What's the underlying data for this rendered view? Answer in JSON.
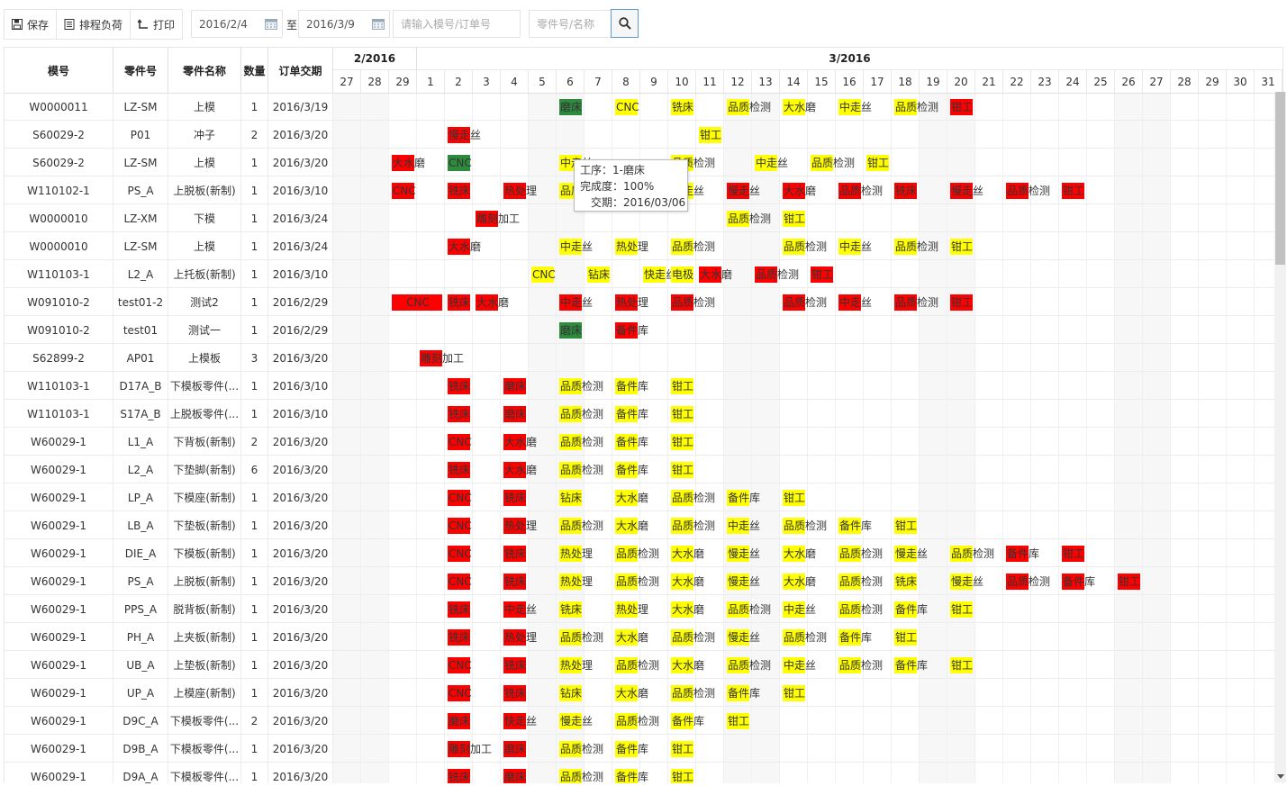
{
  "toolbar": {
    "save": "保存",
    "load": "排程负荷",
    "print": "打印",
    "date_from": "2016/2/4",
    "to": "至",
    "date_to": "2016/3/9",
    "mold_placeholder": "请输入模号/订单号",
    "part_placeholder": "零件号/名称"
  },
  "columns": [
    "模号",
    "零件号",
    "零件名称",
    "数量",
    "订单交期"
  ],
  "months": [
    "2/2016",
    "3/2016"
  ],
  "days": [
    "27",
    "28",
    "29",
    "1",
    "2",
    "3",
    "4",
    "5",
    "6",
    "7",
    "8",
    "9",
    "10",
    "11",
    "12",
    "13",
    "14",
    "15",
    "16",
    "17",
    "18",
    "19",
    "20",
    "21",
    "22",
    "23",
    "24",
    "25",
    "26",
    "27",
    "28",
    "29",
    "30",
    "31"
  ],
  "rows": [
    {
      "mold": "W0000011",
      "part": "LZ-SM",
      "name": "上模",
      "qty": "1",
      "due": "2016/3/19"
    },
    {
      "mold": "S60029-2",
      "part": "P01",
      "name": "冲子",
      "qty": "2",
      "due": "2016/3/20"
    },
    {
      "mold": "S60029-2",
      "part": "LZ-SM",
      "name": "上模",
      "qty": "1",
      "due": "2016/3/20"
    },
    {
      "mold": "W110102-1",
      "part": "PS_A",
      "name": "上脱板(新制)",
      "qty": "1",
      "due": "2016/3/10"
    },
    {
      "mold": "W0000010",
      "part": "LZ-XM",
      "name": "下模",
      "qty": "1",
      "due": "2016/3/24"
    },
    {
      "mold": "W0000010",
      "part": "LZ-SM",
      "name": "上模",
      "qty": "1",
      "due": "2016/3/24"
    },
    {
      "mold": "W110103-1",
      "part": "L2_A",
      "name": "上托板(新制)",
      "qty": "1",
      "due": "2016/3/10"
    },
    {
      "mold": "W091010-2",
      "part": "test01-2",
      "name": "测试2",
      "qty": "1",
      "due": "2016/2/29"
    },
    {
      "mold": "W091010-2",
      "part": "test01",
      "name": "测试一",
      "qty": "1",
      "due": "2016/2/29"
    },
    {
      "mold": "S62899-2",
      "part": "AP01",
      "name": "上模板",
      "qty": "3",
      "due": "2016/3/20"
    },
    {
      "mold": "W110103-1",
      "part": "D17A_B",
      "name": "下模板零件(...",
      "qty": "1",
      "due": "2016/3/10"
    },
    {
      "mold": "W110103-1",
      "part": "S17A_B",
      "name": "上脱板零件(...",
      "qty": "1",
      "due": "2016/3/10"
    },
    {
      "mold": "W60029-1",
      "part": "L1_A",
      "name": "下背板(新制)",
      "qty": "2",
      "due": "2016/3/20"
    },
    {
      "mold": "W60029-1",
      "part": "L2_A",
      "name": "下垫脚(新制)",
      "qty": "6",
      "due": "2016/3/20"
    },
    {
      "mold": "W60029-1",
      "part": "LP_A",
      "name": "下模座(新制)",
      "qty": "1",
      "due": "2016/3/20"
    },
    {
      "mold": "W60029-1",
      "part": "LB_A",
      "name": "下垫板(新制)",
      "qty": "1",
      "due": "2016/3/20"
    },
    {
      "mold": "W60029-1",
      "part": "DIE_A",
      "name": "下模板(新制)",
      "qty": "1",
      "due": "2016/3/20"
    },
    {
      "mold": "W60029-1",
      "part": "PS_A",
      "name": "上脱板(新制)",
      "qty": "1",
      "due": "2016/3/20"
    },
    {
      "mold": "W60029-1",
      "part": "PPS_A",
      "name": "脱背板(新制)",
      "qty": "1",
      "due": "2016/3/20"
    },
    {
      "mold": "W60029-1",
      "part": "PH_A",
      "name": "上夹板(新制)",
      "qty": "1",
      "due": "2016/3/20"
    },
    {
      "mold": "W60029-1",
      "part": "UB_A",
      "name": "上垫板(新制)",
      "qty": "1",
      "due": "2016/3/20"
    },
    {
      "mold": "W60029-1",
      "part": "UP_A",
      "name": "上模座(新制)",
      "qty": "1",
      "due": "2016/3/20"
    },
    {
      "mold": "W60029-1",
      "part": "D9C_A",
      "name": "下模板零件(...",
      "qty": "2",
      "due": "2016/3/20"
    },
    {
      "mold": "W60029-1",
      "part": "D9B_A",
      "name": "下模板零件(...",
      "qty": "1",
      "due": "2016/3/20"
    },
    {
      "mold": "W60029-1",
      "part": "D9A_A",
      "name": "下模板零件(...",
      "qty": "1",
      "due": "2016/3/20"
    }
  ],
  "tasks": [
    [
      {
        "c": 8,
        "t": "磨床",
        "k": "g"
      },
      {
        "c": 10,
        "t": "CNC",
        "k": "y"
      },
      {
        "c": 12,
        "t": "铣床",
        "k": "y"
      },
      {
        "c": 14,
        "t": "品质检测",
        "k": "y"
      },
      {
        "c": 16,
        "t": "大水磨",
        "k": "y"
      },
      {
        "c": 18,
        "t": "中走丝",
        "k": "y"
      },
      {
        "c": 20,
        "t": "品质检测",
        "k": "y"
      },
      {
        "c": 22,
        "t": "钳工",
        "k": "r"
      }
    ],
    [
      {
        "c": 4,
        "t": "慢走丝",
        "k": "r"
      },
      {
        "c": 13,
        "t": "钳工",
        "k": "y"
      }
    ],
    [
      {
        "c": 2,
        "t": "大水磨",
        "k": "r"
      },
      {
        "c": 4,
        "t": "CNC",
        "k": "g"
      },
      {
        "c": 8,
        "t": "中走丝",
        "k": "y"
      },
      {
        "c": 12,
        "t": "品质检测",
        "k": "y"
      },
      {
        "c": 15,
        "t": "中走丝",
        "k": "y"
      },
      {
        "c": 17,
        "t": "品质检测",
        "k": "y"
      },
      {
        "c": 19,
        "t": "钳工",
        "k": "y"
      }
    ],
    [
      {
        "c": 2,
        "t": "CNC",
        "k": "r"
      },
      {
        "c": 4,
        "t": "铣床",
        "k": "r"
      },
      {
        "c": 6,
        "t": "热处理",
        "k": "r"
      },
      {
        "c": 8,
        "t": "品质检测",
        "k": "y"
      },
      {
        "c": 10,
        "t": "大水磨",
        "k": "y"
      },
      {
        "c": 12,
        "t": "快走丝",
        "k": "y"
      },
      {
        "c": 14,
        "t": "慢走丝",
        "k": "r"
      },
      {
        "c": 16,
        "t": "大水磨",
        "k": "r"
      },
      {
        "c": 18,
        "t": "品质检测",
        "k": "r"
      },
      {
        "c": 20,
        "t": "铣床",
        "k": "r"
      },
      {
        "c": 22,
        "t": "慢走丝",
        "k": "r"
      },
      {
        "c": 24,
        "t": "品质检测",
        "k": "r"
      },
      {
        "c": 26,
        "t": "钳工",
        "k": "r"
      }
    ],
    [
      {
        "c": 5,
        "t": "雕刻加工",
        "k": "r"
      },
      {
        "c": 14,
        "t": "品质检测",
        "k": "y"
      },
      {
        "c": 16,
        "t": "钳工",
        "k": "y"
      }
    ],
    [
      {
        "c": 4,
        "t": "大水磨",
        "k": "r"
      },
      {
        "c": 8,
        "t": "中走丝",
        "k": "y"
      },
      {
        "c": 10,
        "t": "热处理",
        "k": "y"
      },
      {
        "c": 12,
        "t": "品质检测",
        "k": "y"
      },
      {
        "c": 16,
        "t": "品质检测",
        "k": "y"
      },
      {
        "c": 18,
        "t": "中走丝",
        "k": "y"
      },
      {
        "c": 20,
        "t": "品质检测",
        "k": "y"
      },
      {
        "c": 22,
        "t": "钳工",
        "k": "y"
      }
    ],
    [
      {
        "c": 7,
        "t": "CNC",
        "k": "y"
      },
      {
        "c": 9,
        "t": "钻床",
        "k": "y"
      },
      {
        "c": 11,
        "t": "快走丝",
        "k": "y"
      },
      {
        "c": 12,
        "t": "电极",
        "k": "y"
      },
      {
        "c": 13,
        "t": "大水磨",
        "k": "r"
      },
      {
        "c": 15,
        "t": "品质检测",
        "k": "r"
      },
      {
        "c": 17,
        "t": "钳工",
        "k": "r"
      }
    ],
    [
      {
        "c": 2,
        "t": "CNC",
        "k": "r",
        "w": 2
      },
      {
        "c": 4,
        "t": "铣床",
        "k": "r"
      },
      {
        "c": 5,
        "t": "大水磨",
        "k": "r"
      },
      {
        "c": 8,
        "t": "中走丝",
        "k": "r"
      },
      {
        "c": 10,
        "t": "热处理",
        "k": "r"
      },
      {
        "c": 12,
        "t": "品质检测",
        "k": "r"
      },
      {
        "c": 16,
        "t": "品质检测",
        "k": "r"
      },
      {
        "c": 18,
        "t": "中走丝",
        "k": "r"
      },
      {
        "c": 20,
        "t": "品质检测",
        "k": "r"
      },
      {
        "c": 22,
        "t": "钳工",
        "k": "r"
      }
    ],
    [
      {
        "c": 8,
        "t": "磨床",
        "k": "g"
      },
      {
        "c": 10,
        "t": "备件库",
        "k": "r"
      }
    ],
    [
      {
        "c": 3,
        "t": "雕刻加工",
        "k": "r"
      }
    ],
    [
      {
        "c": 4,
        "t": "铣床",
        "k": "r"
      },
      {
        "c": 6,
        "t": "磨床",
        "k": "r"
      },
      {
        "c": 8,
        "t": "品质检测",
        "k": "y"
      },
      {
        "c": 10,
        "t": "备件库",
        "k": "y"
      },
      {
        "c": 12,
        "t": "钳工",
        "k": "y"
      }
    ],
    [
      {
        "c": 4,
        "t": "铣床",
        "k": "r"
      },
      {
        "c": 6,
        "t": "磨床",
        "k": "r"
      },
      {
        "c": 8,
        "t": "品质检测",
        "k": "y"
      },
      {
        "c": 10,
        "t": "备件库",
        "k": "y"
      },
      {
        "c": 12,
        "t": "钳工",
        "k": "y"
      }
    ],
    [
      {
        "c": 4,
        "t": "CNC",
        "k": "r"
      },
      {
        "c": 6,
        "t": "大水磨",
        "k": "r"
      },
      {
        "c": 8,
        "t": "品质检测",
        "k": "y"
      },
      {
        "c": 10,
        "t": "备件库",
        "k": "y"
      },
      {
        "c": 12,
        "t": "钳工",
        "k": "y"
      }
    ],
    [
      {
        "c": 4,
        "t": "铣床",
        "k": "r"
      },
      {
        "c": 6,
        "t": "大水磨",
        "k": "r"
      },
      {
        "c": 8,
        "t": "品质检测",
        "k": "y"
      },
      {
        "c": 10,
        "t": "备件库",
        "k": "y"
      },
      {
        "c": 12,
        "t": "钳工",
        "k": "y"
      }
    ],
    [
      {
        "c": 4,
        "t": "CNC",
        "k": "r"
      },
      {
        "c": 6,
        "t": "铣床",
        "k": "r"
      },
      {
        "c": 8,
        "t": "钻床",
        "k": "y"
      },
      {
        "c": 10,
        "t": "大水磨",
        "k": "y"
      },
      {
        "c": 12,
        "t": "品质检测",
        "k": "y"
      },
      {
        "c": 14,
        "t": "备件库",
        "k": "y"
      },
      {
        "c": 16,
        "t": "钳工",
        "k": "y"
      }
    ],
    [
      {
        "c": 4,
        "t": "CNC",
        "k": "r"
      },
      {
        "c": 6,
        "t": "热处理",
        "k": "r"
      },
      {
        "c": 8,
        "t": "品质检测",
        "k": "y"
      },
      {
        "c": 10,
        "t": "大水磨",
        "k": "y"
      },
      {
        "c": 12,
        "t": "品质检测",
        "k": "y"
      },
      {
        "c": 14,
        "t": "中走丝",
        "k": "y"
      },
      {
        "c": 16,
        "t": "品质检测",
        "k": "y"
      },
      {
        "c": 18,
        "t": "备件库",
        "k": "y"
      },
      {
        "c": 20,
        "t": "钳工",
        "k": "y"
      }
    ],
    [
      {
        "c": 4,
        "t": "CNC",
        "k": "r"
      },
      {
        "c": 6,
        "t": "铣床",
        "k": "r"
      },
      {
        "c": 8,
        "t": "热处理",
        "k": "y"
      },
      {
        "c": 10,
        "t": "品质检测",
        "k": "y"
      },
      {
        "c": 12,
        "t": "大水磨",
        "k": "y"
      },
      {
        "c": 14,
        "t": "慢走丝",
        "k": "y"
      },
      {
        "c": 16,
        "t": "大水磨",
        "k": "y"
      },
      {
        "c": 18,
        "t": "品质检测",
        "k": "y"
      },
      {
        "c": 20,
        "t": "慢走丝",
        "k": "y"
      },
      {
        "c": 22,
        "t": "品质检测",
        "k": "y"
      },
      {
        "c": 24,
        "t": "备件库",
        "k": "r"
      },
      {
        "c": 26,
        "t": "钳工",
        "k": "r"
      }
    ],
    [
      {
        "c": 4,
        "t": "CNC",
        "k": "r"
      },
      {
        "c": 6,
        "t": "铣床",
        "k": "r"
      },
      {
        "c": 8,
        "t": "热处理",
        "k": "y"
      },
      {
        "c": 10,
        "t": "品质检测",
        "k": "y"
      },
      {
        "c": 12,
        "t": "大水磨",
        "k": "y"
      },
      {
        "c": 14,
        "t": "慢走丝",
        "k": "y"
      },
      {
        "c": 16,
        "t": "大水磨",
        "k": "y"
      },
      {
        "c": 18,
        "t": "品质检测",
        "k": "y"
      },
      {
        "c": 20,
        "t": "铣床",
        "k": "y"
      },
      {
        "c": 22,
        "t": "慢走丝",
        "k": "y"
      },
      {
        "c": 24,
        "t": "品质检测",
        "k": "r"
      },
      {
        "c": 26,
        "t": "备件库",
        "k": "r"
      },
      {
        "c": 28,
        "t": "钳工",
        "k": "r"
      }
    ],
    [
      {
        "c": 4,
        "t": "铣床",
        "k": "r"
      },
      {
        "c": 6,
        "t": "中走丝",
        "k": "r"
      },
      {
        "c": 8,
        "t": "铣床",
        "k": "y"
      },
      {
        "c": 10,
        "t": "热处理",
        "k": "y"
      },
      {
        "c": 12,
        "t": "大水磨",
        "k": "y"
      },
      {
        "c": 14,
        "t": "品质检测",
        "k": "y"
      },
      {
        "c": 16,
        "t": "中走丝",
        "k": "y"
      },
      {
        "c": 18,
        "t": "品质检测",
        "k": "y"
      },
      {
        "c": 20,
        "t": "备件库",
        "k": "y"
      },
      {
        "c": 22,
        "t": "钳工",
        "k": "y"
      }
    ],
    [
      {
        "c": 4,
        "t": "铣床",
        "k": "r"
      },
      {
        "c": 6,
        "t": "热处理",
        "k": "r"
      },
      {
        "c": 8,
        "t": "品质检测",
        "k": "y"
      },
      {
        "c": 10,
        "t": "大水磨",
        "k": "y"
      },
      {
        "c": 12,
        "t": "品质检测",
        "k": "y"
      },
      {
        "c": 14,
        "t": "慢走丝",
        "k": "y"
      },
      {
        "c": 16,
        "t": "品质检测",
        "k": "y"
      },
      {
        "c": 18,
        "t": "备件库",
        "k": "y"
      },
      {
        "c": 20,
        "t": "钳工",
        "k": "y"
      }
    ],
    [
      {
        "c": 4,
        "t": "CNC",
        "k": "r"
      },
      {
        "c": 6,
        "t": "铣床",
        "k": "r"
      },
      {
        "c": 8,
        "t": "热处理",
        "k": "y"
      },
      {
        "c": 10,
        "t": "品质检测",
        "k": "y"
      },
      {
        "c": 12,
        "t": "大水磨",
        "k": "y"
      },
      {
        "c": 14,
        "t": "品质检测",
        "k": "y"
      },
      {
        "c": 16,
        "t": "中走丝",
        "k": "y"
      },
      {
        "c": 18,
        "t": "品质检测",
        "k": "y"
      },
      {
        "c": 20,
        "t": "备件库",
        "k": "y"
      },
      {
        "c": 22,
        "t": "钳工",
        "k": "y"
      }
    ],
    [
      {
        "c": 4,
        "t": "CNC",
        "k": "r"
      },
      {
        "c": 6,
        "t": "铣床",
        "k": "r"
      },
      {
        "c": 8,
        "t": "钻床",
        "k": "y"
      },
      {
        "c": 10,
        "t": "大水磨",
        "k": "y"
      },
      {
        "c": 12,
        "t": "品质检测",
        "k": "y"
      },
      {
        "c": 14,
        "t": "备件库",
        "k": "y"
      },
      {
        "c": 16,
        "t": "钳工",
        "k": "y"
      }
    ],
    [
      {
        "c": 4,
        "t": "磨床",
        "k": "r"
      },
      {
        "c": 6,
        "t": "快走丝",
        "k": "r"
      },
      {
        "c": 8,
        "t": "慢走丝",
        "k": "y"
      },
      {
        "c": 10,
        "t": "品质检测",
        "k": "y"
      },
      {
        "c": 12,
        "t": "备件库",
        "k": "y"
      },
      {
        "c": 14,
        "t": "钳工",
        "k": "y"
      }
    ],
    [
      {
        "c": 4,
        "t": "雕刻加工",
        "k": "r"
      },
      {
        "c": 6,
        "t": "磨床",
        "k": "r"
      },
      {
        "c": 8,
        "t": "品质检测",
        "k": "y"
      },
      {
        "c": 10,
        "t": "备件库",
        "k": "y"
      },
      {
        "c": 12,
        "t": "钳工",
        "k": "y"
      }
    ],
    [
      {
        "c": 4,
        "t": "铣床",
        "k": "r"
      },
      {
        "c": 6,
        "t": "磨床",
        "k": "r"
      },
      {
        "c": 8,
        "t": "品质检测",
        "k": "y"
      },
      {
        "c": 10,
        "t": "备件库",
        "k": "y"
      },
      {
        "c": 12,
        "t": "钳工",
        "k": "y"
      }
    ]
  ],
  "tooltip": {
    "process": "工序：1-磨床",
    "progress": "完成度：100%",
    "due": "交期：2016/03/06"
  },
  "colors": {
    "red": "#ff0000",
    "yellow": "#ffff00",
    "green": "#2e8b3e"
  }
}
